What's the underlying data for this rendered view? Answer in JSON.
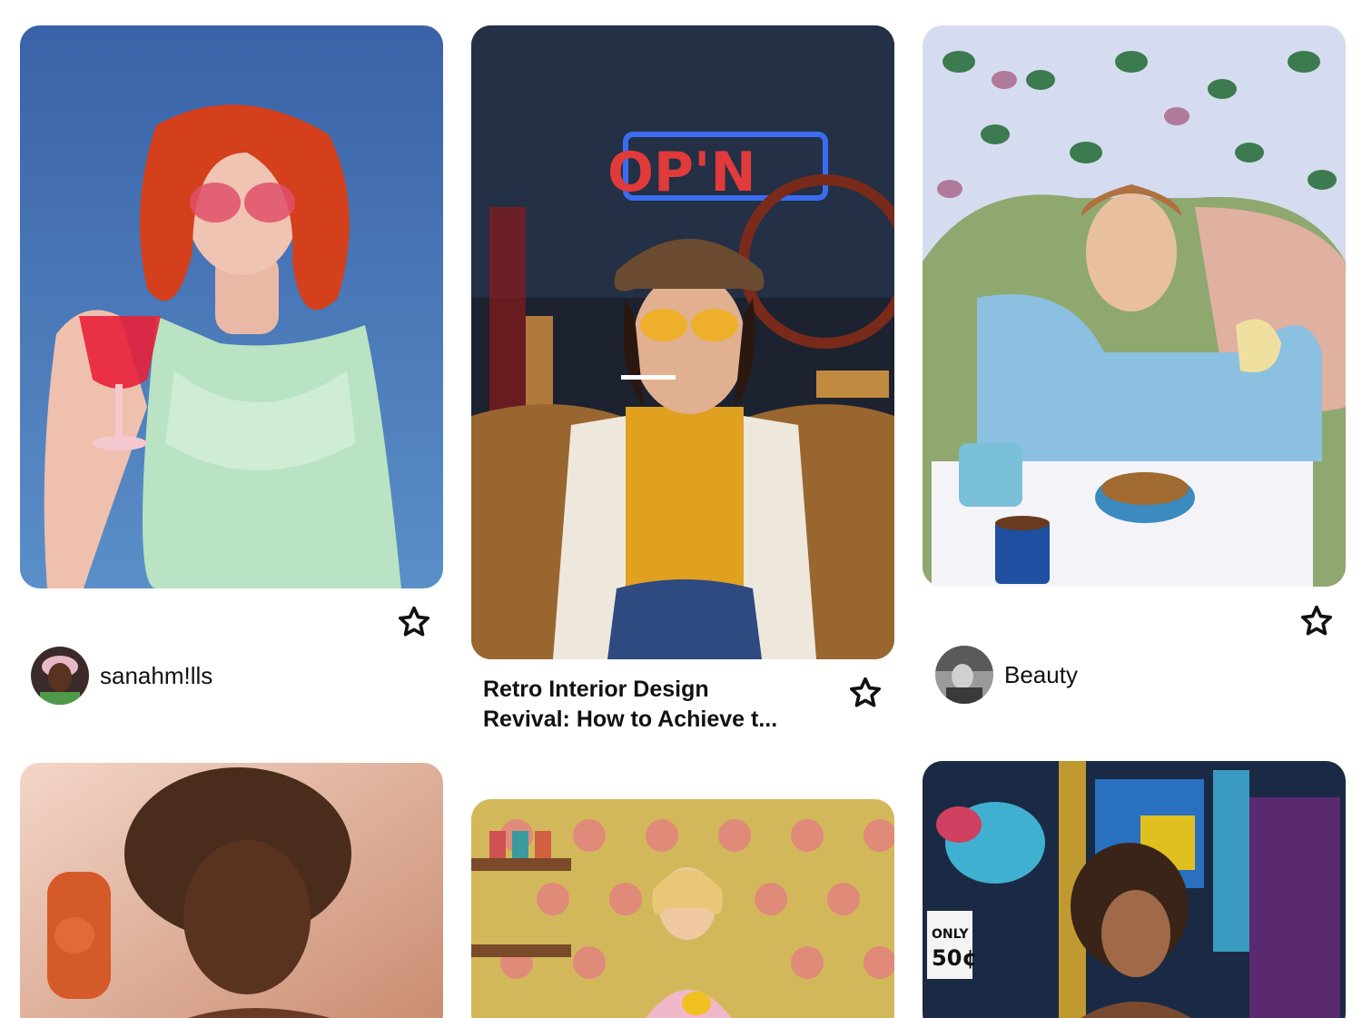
{
  "pins": [
    {
      "creator": "sanahm!lls",
      "image": "retro red-haired woman in mint green slip holding red drink"
    },
    {
      "title_line1": "Retro Interior Design",
      "title_line2": "Revival: How to Achieve t...",
      "image": "woman in yellow sunglasses and newsboy cap with neon open sign"
    },
    {
      "creator": "Beauty",
      "image": "woman in blue on phone pouring milk on cereal"
    },
    {
      "image": "woman with afro holding orange rotary phone"
    },
    {
      "image": "blonde woman in retro kitchen with flower wallpaper"
    },
    {
      "image": "woman with curly hair in arcade by claw machine"
    }
  ],
  "icons": {
    "save": "star-icon"
  },
  "colors": {
    "text": "#111111",
    "background": "#ffffff"
  }
}
